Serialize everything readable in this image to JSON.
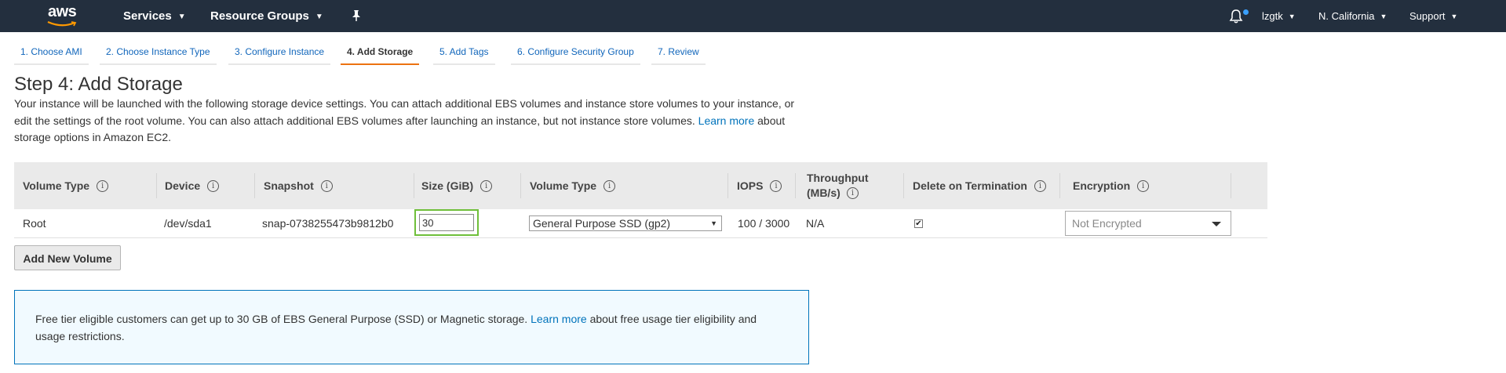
{
  "nav": {
    "logo": "aws",
    "services": "Services",
    "resource_groups": "Resource Groups",
    "user": "lzgtk",
    "region": "N. California",
    "support": "Support"
  },
  "tabs": [
    {
      "label": "1. Choose AMI"
    },
    {
      "label": "2. Choose Instance Type"
    },
    {
      "label": "3. Configure Instance"
    },
    {
      "label": "4. Add Storage"
    },
    {
      "label": "5. Add Tags"
    },
    {
      "label": "6. Configure Security Group"
    },
    {
      "label": "7. Review"
    }
  ],
  "page": {
    "title": "Step 4: Add Storage",
    "desc_before": "Your instance will be launched with the following storage device settings. You can attach additional EBS volumes and instance store volumes to your instance, or edit the settings of the root volume. You can also attach additional EBS volumes after launching an instance, but not instance store volumes.",
    "desc_link": "Learn more",
    "desc_after": "about storage options in Amazon EC2."
  },
  "table": {
    "headers": {
      "volume_type": "Volume Type",
      "device": "Device",
      "snapshot": "Snapshot",
      "size": "Size (GiB)",
      "volume_type2": "Volume Type",
      "iops": "IOPS",
      "throughput": "Throughput (MB/s)",
      "delete": "Delete on Termination",
      "encryption": "Encryption"
    },
    "row": {
      "volume_type": "Root",
      "device": "/dev/sda1",
      "snapshot": "snap-0738255473b9812b0",
      "size": "30",
      "volume_type_select": "General Purpose SSD (gp2)",
      "iops": "100 / 3000",
      "throughput": "N/A",
      "delete_checked": true,
      "encryption": "Not Encrypted"
    },
    "info_glyph": "i",
    "check_glyph": "✔"
  },
  "add_button": "Add New Volume",
  "infobox": {
    "before": "Free tier eligible customers can get up to 30 GB of EBS General Purpose (SSD) or Magnetic storage.",
    "link": "Learn more",
    "after": "about free usage tier eligibility and usage restrictions."
  },
  "colors": {
    "nav_bg": "#232f3e",
    "active_tab": "#ec7211",
    "link": "#0073bb",
    "size_highlight": "#6fbf3a",
    "infobox_border": "#0073bb",
    "infobox_bg": "#f1faff"
  },
  "icons": [
    "aws-logo-icon",
    "pin-icon",
    "bell-icon",
    "info-icon",
    "chevron-down-icon",
    "checkbox-icon"
  ]
}
